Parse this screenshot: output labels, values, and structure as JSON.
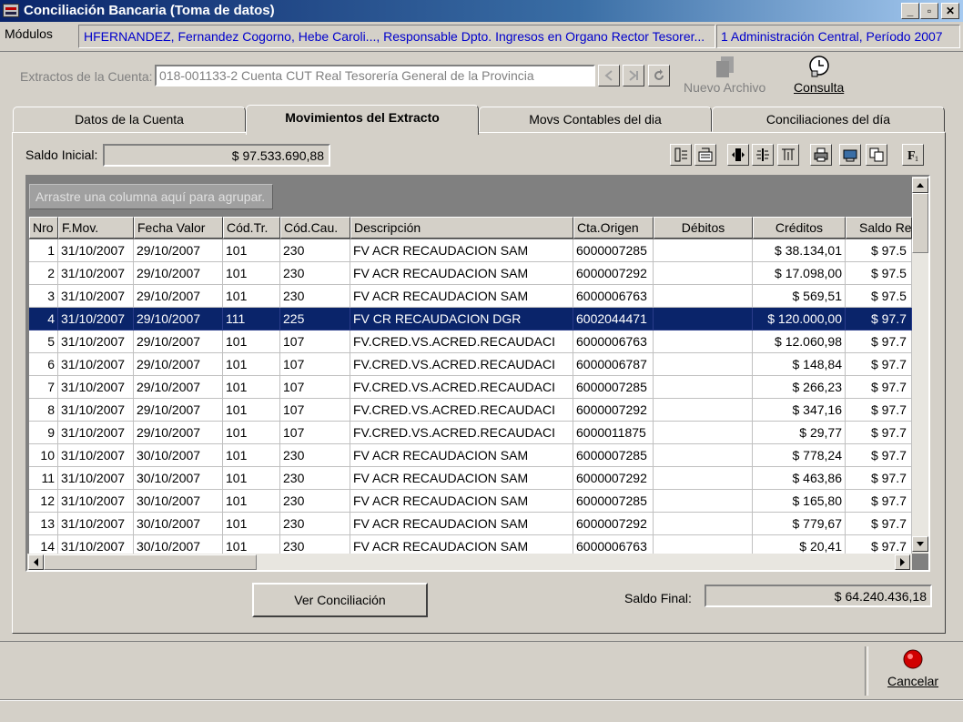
{
  "window": {
    "title": "Conciliación Bancaria (Toma de datos)",
    "controls": {
      "minimize": "_",
      "maximize": "▫",
      "close": "✕"
    }
  },
  "infobar": {
    "modulos": "Módulos",
    "user": "HFERNANDEZ, Fernandez Cogorno, Hebe Caroli..., Responsable Dpto. Ingresos en Organo Rector Tesorer...",
    "context": "1 Administración Central, Período 2007"
  },
  "extract": {
    "label": "Extractos de la Cuenta:",
    "value": "018-001133-2 Cuenta CUT Real Tesorería General de la Provincia"
  },
  "toolbar": {
    "nuevo_archivo": "Nuevo Archivo",
    "consulta": "Consulta"
  },
  "tabs": [
    {
      "label": "Datos de la Cuenta"
    },
    {
      "label": "Movimientos del Extracto"
    },
    {
      "label": "Movs Contables del dia"
    },
    {
      "label": "Conciliaciones del día"
    }
  ],
  "saldo_inicial": {
    "label": "Saldo Inicial:",
    "value": "$ 97.533.690,88"
  },
  "group_hint": "Arrastre una columna aquí para agrupar.",
  "columns": [
    "Nro",
    "F.Mov.",
    "Fecha Valor",
    "Cód.Tr.",
    "Cód.Cau.",
    "Descripción",
    "Cta.Origen",
    "Débitos",
    "Créditos",
    "Saldo Re"
  ],
  "rows": [
    {
      "nro": "1",
      "fmov": "31/10/2007",
      "fvalor": "29/10/2007",
      "codtr": "101",
      "codcau": "230",
      "desc": "FV ACR RECAUDACION SAM",
      "cta": "6000007285",
      "deb": "",
      "cred": "$ 38.134,01",
      "saldo": "$ 97.5"
    },
    {
      "nro": "2",
      "fmov": "31/10/2007",
      "fvalor": "29/10/2007",
      "codtr": "101",
      "codcau": "230",
      "desc": "FV ACR RECAUDACION SAM",
      "cta": "6000007292",
      "deb": "",
      "cred": "$ 17.098,00",
      "saldo": "$ 97.5"
    },
    {
      "nro": "3",
      "fmov": "31/10/2007",
      "fvalor": "29/10/2007",
      "codtr": "101",
      "codcau": "230",
      "desc": "FV ACR RECAUDACION SAM",
      "cta": "6000006763",
      "deb": "",
      "cred": "$ 569,51",
      "saldo": "$ 97.5"
    },
    {
      "nro": "4",
      "fmov": "31/10/2007",
      "fvalor": "29/10/2007",
      "codtr": "111",
      "codcau": "225",
      "desc": "FV  CR RECAUDACION DGR",
      "cta": "6002044471",
      "deb": "",
      "cred": "$ 120.000,00",
      "saldo": "$ 97.7",
      "selected": true
    },
    {
      "nro": "5",
      "fmov": "31/10/2007",
      "fvalor": "29/10/2007",
      "codtr": "101",
      "codcau": "107",
      "desc": "FV.CRED.VS.ACRED.RECAUDACI",
      "cta": "6000006763",
      "deb": "",
      "cred": "$ 12.060,98",
      "saldo": "$ 97.7"
    },
    {
      "nro": "6",
      "fmov": "31/10/2007",
      "fvalor": "29/10/2007",
      "codtr": "101",
      "codcau": "107",
      "desc": "FV.CRED.VS.ACRED.RECAUDACI",
      "cta": "6000006787",
      "deb": "",
      "cred": "$ 148,84",
      "saldo": "$ 97.7"
    },
    {
      "nro": "7",
      "fmov": "31/10/2007",
      "fvalor": "29/10/2007",
      "codtr": "101",
      "codcau": "107",
      "desc": "FV.CRED.VS.ACRED.RECAUDACI",
      "cta": "6000007285",
      "deb": "",
      "cred": "$ 266,23",
      "saldo": "$ 97.7"
    },
    {
      "nro": "8",
      "fmov": "31/10/2007",
      "fvalor": "29/10/2007",
      "codtr": "101",
      "codcau": "107",
      "desc": "FV.CRED.VS.ACRED.RECAUDACI",
      "cta": "6000007292",
      "deb": "",
      "cred": "$ 347,16",
      "saldo": "$ 97.7"
    },
    {
      "nro": "9",
      "fmov": "31/10/2007",
      "fvalor": "29/10/2007",
      "codtr": "101",
      "codcau": "107",
      "desc": "FV.CRED.VS.ACRED.RECAUDACI",
      "cta": "6000011875",
      "deb": "",
      "cred": "$ 29,77",
      "saldo": "$ 97.7"
    },
    {
      "nro": "10",
      "fmov": "31/10/2007",
      "fvalor": "30/10/2007",
      "codtr": "101",
      "codcau": "230",
      "desc": "FV ACR RECAUDACION SAM",
      "cta": "6000007285",
      "deb": "",
      "cred": "$ 778,24",
      "saldo": "$ 97.7"
    },
    {
      "nro": "11",
      "fmov": "31/10/2007",
      "fvalor": "30/10/2007",
      "codtr": "101",
      "codcau": "230",
      "desc": "FV ACR RECAUDACION SAM",
      "cta": "6000007292",
      "deb": "",
      "cred": "$ 463,86",
      "saldo": "$ 97.7"
    },
    {
      "nro": "12",
      "fmov": "31/10/2007",
      "fvalor": "30/10/2007",
      "codtr": "101",
      "codcau": "230",
      "desc": "FV ACR RECAUDACION SAM",
      "cta": "6000007285",
      "deb": "",
      "cred": "$ 165,80",
      "saldo": "$ 97.7"
    },
    {
      "nro": "13",
      "fmov": "31/10/2007",
      "fvalor": "30/10/2007",
      "codtr": "101",
      "codcau": "230",
      "desc": "FV ACR RECAUDACION SAM",
      "cta": "6000007292",
      "deb": "",
      "cred": "$ 779,67",
      "saldo": "$ 97.7"
    },
    {
      "nro": "14",
      "fmov": "31/10/2007",
      "fvalor": "30/10/2007",
      "codtr": "101",
      "codcau": "230",
      "desc": "FV ACR RECAUDACION SAM",
      "cta": "6000006763",
      "deb": "",
      "cred": "$ 20,41",
      "saldo": "$ 97.7"
    }
  ],
  "buttons": {
    "ver_conciliacion": "Ver Conciliación",
    "cancelar": "Cancelar"
  },
  "saldo_final": {
    "label": "Saldo Final:",
    "value": "$ 64.240.436,18"
  },
  "colors": {
    "title_start": "#0a246a",
    "selection": "#0a246a",
    "info_text": "#0000cc",
    "face": "#d4d0c8"
  }
}
